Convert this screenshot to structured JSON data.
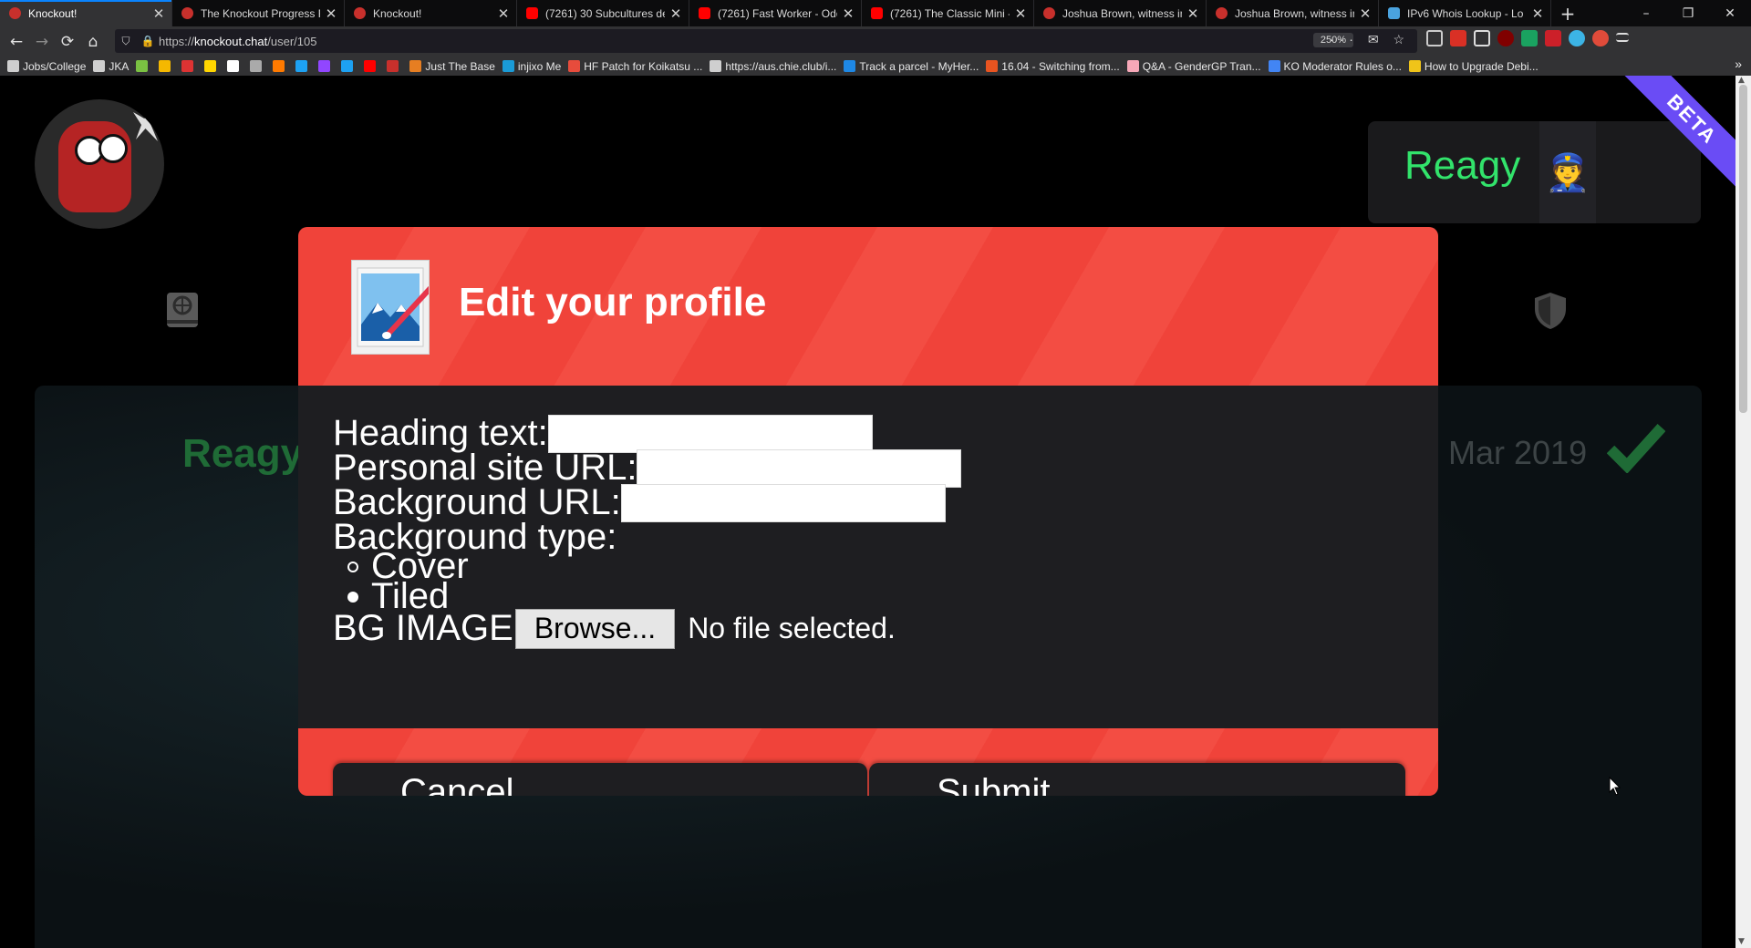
{
  "tabs": [
    {
      "title": "Knockout!",
      "favicon_color": "#c8302c",
      "active": true
    },
    {
      "title": "The Knockout Progress R",
      "favicon_color": "#c8302c"
    },
    {
      "title": "Knockout!",
      "favicon_color": "#c8302c"
    },
    {
      "title": "(7261) 30 Subcultures de",
      "favicon_color": "#ff0000"
    },
    {
      "title": "(7261) Fast Worker - Odd",
      "favicon_color": "#ff0000"
    },
    {
      "title": "(7261) The Classic Mini -",
      "favicon_color": "#ff0000"
    },
    {
      "title": "Joshua Brown, witness in",
      "favicon_color": "#c8302c"
    },
    {
      "title": "Joshua Brown, witness in",
      "favicon_color": "#c8302c"
    },
    {
      "title": "IPv6 Whois Lookup - Lo",
      "favicon_color": "#4aa3df"
    }
  ],
  "window_controls": {
    "minimize": "–",
    "maximize": "❐",
    "close": "✕"
  },
  "tab_close_glyph": "✕",
  "new_tab_glyph": "+",
  "nav": {
    "back": "←",
    "forward": "→",
    "reload": "⟳",
    "home": "⌂"
  },
  "url": {
    "scheme": "https://",
    "host": "knockout.chat",
    "path": "/user/105"
  },
  "zoom": "250%",
  "url_actions": "··· ✉ ☆",
  "bookmarks": [
    {
      "label": "Jobs/College",
      "color": "#cfcfcf"
    },
    {
      "label": "JKA",
      "color": "#cfcfcf"
    },
    {
      "label": "",
      "color": "#7ac142"
    },
    {
      "label": "",
      "color": "#f5b800"
    },
    {
      "label": "",
      "color": "#d33"
    },
    {
      "label": "",
      "color": "#ffd500"
    },
    {
      "label": "",
      "color": "#fff"
    },
    {
      "label": "",
      "color": "#aaa"
    },
    {
      "label": "",
      "color": "#ff7a00"
    },
    {
      "label": "",
      "color": "#1da1f2"
    },
    {
      "label": "",
      "color": "#9146ff"
    },
    {
      "label": "",
      "color": "#1da1f2"
    },
    {
      "label": "",
      "color": "#ff0000"
    },
    {
      "label": "",
      "color": "#c8302c"
    },
    {
      "label": "Just The Base",
      "color": "#e67e22"
    },
    {
      "label": "injixo Me",
      "color": "#1a9bd7"
    },
    {
      "label": "HF Patch for Koikatsu ...",
      "color": "#e74c3c"
    },
    {
      "label": "https://aus.chie.club/i...",
      "color": "#cfcfcf"
    },
    {
      "label": "Track a parcel - MyHer...",
      "color": "#1e88e5"
    },
    {
      "label": "16.04 - Switching from...",
      "color": "#e95420"
    },
    {
      "label": "Q&A - GenderGP Tran...",
      "color": "#f7a8b8"
    },
    {
      "label": "KO Moderator Rules o...",
      "color": "#4285f4"
    },
    {
      "label": "How to Upgrade Debi...",
      "color": "#f0c419"
    }
  ],
  "bookmarks_overflow": "»",
  "header": {
    "username": "Reagy",
    "avatar_emoji": "👮",
    "beta_label": "BETA"
  },
  "profile_bg": {
    "name": "Reagy",
    "joined": "Mar 2019"
  },
  "modal": {
    "title": "Edit your profile",
    "fields": [
      {
        "label": "Heading text:",
        "value": ""
      },
      {
        "label": "Personal site URL:",
        "value": ""
      },
      {
        "label": "Background URL:",
        "value": ""
      }
    ],
    "background_type_label": "Background type:",
    "background_type_options": [
      "Cover",
      "Tiled"
    ],
    "bg_image_label": "BG IMAGE",
    "browse_label": "Browse...",
    "no_file_label": "No file selected.",
    "cancel_label": "Cancel",
    "submit_label": "Submit"
  },
  "scroll": {
    "up": "▲",
    "down": "▼"
  },
  "colors": {
    "accent_red": "#f0433a",
    "username_green": "#32e36b",
    "beta_purple": "#6a4cf5",
    "modal_bg": "#1e1e21"
  }
}
